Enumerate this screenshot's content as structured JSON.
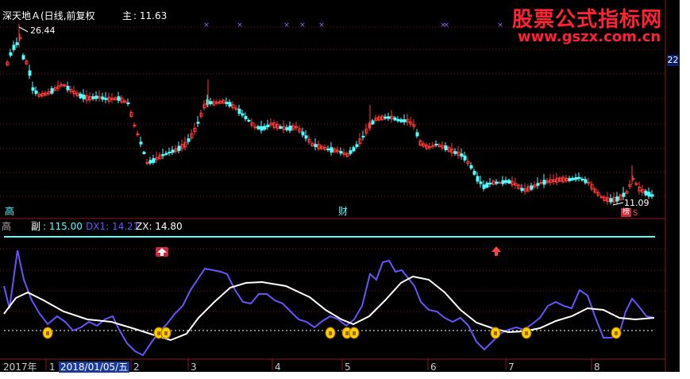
{
  "main_panel": {
    "stock_title": "深天地Ａ(日线,前复权",
    "close_label": "主",
    "close_value": ": 11.63",
    "high_marker": "26.44",
    "low_marker": "11.09",
    "price_tag": "22",
    "label_high": "高",
    "label_cai": "财",
    "label_bang": "榜",
    "label_s": "S"
  },
  "indicator_panel": {
    "side_label": "高",
    "name_label": "副",
    "value_main": ": 115.00",
    "dx1_label": "DX1: 14.21",
    "zx_label": "ZX: 14.80"
  },
  "time_axis": {
    "year_label": "2017年",
    "selected_date": "2018/01/05/五",
    "month_ticks": [
      "1",
      "2",
      "3",
      "4",
      "5",
      "6",
      "7",
      "8"
    ]
  },
  "watermark": {
    "cn": "股票公式指标网",
    "url": "www.gszx.com.cn"
  },
  "colors": {
    "background": "#000000",
    "up_candle": "#ff3b3b",
    "down_candle": "#54ffff",
    "cyan_line": "#54ffff",
    "dx1_line": "#6655ff",
    "zx_line": "#ffffff",
    "signal_dot": "#ffcc00",
    "title_text": "#ffffff",
    "watermark": "#ff2233"
  }
}
